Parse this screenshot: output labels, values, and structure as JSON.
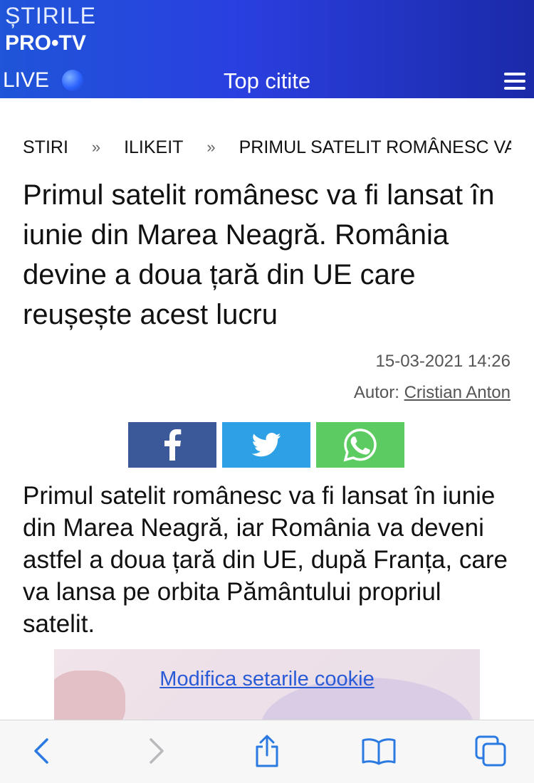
{
  "header": {
    "brand_line1": "ȘTIRILE",
    "brand_line2": "PRO•TV",
    "live_label": "LIVE",
    "top_read_label": "Top citite"
  },
  "breadcrumb": {
    "items": [
      "STIRI",
      "ILIKEIT",
      "PRIMUL SATELIT ROMÂNESC VA FI LANSAT"
    ],
    "separator": "»"
  },
  "article": {
    "title": "Primul satelit românesc va fi lansat în iunie din Marea Neagră. România devine a doua țară din UE care reușește acest lucru",
    "date": "15-03-2021 14:26",
    "author_label": "Autor:",
    "author_name": "Cristian Anton",
    "lead": "Primul satelit românesc va fi lansat în iunie din Marea Neagră, iar România va deveni astfel a doua țară din UE, după Franța, care va lansa pe orbita Pământului propriul satelit."
  },
  "share": {
    "buttons": [
      "facebook-icon",
      "twitter-icon",
      "whatsapp-icon"
    ],
    "colors": {
      "facebook": "#3b5998",
      "twitter": "#2ea1e6",
      "whatsapp": "#5ccc62"
    }
  },
  "cookie": {
    "link_label": "Modifica setarile cookie"
  },
  "toolbar": {
    "icons": [
      "back-icon",
      "forward-icon",
      "share-icon",
      "bookmarks-icon",
      "tabs-icon"
    ]
  },
  "colors": {
    "header_blue": "#2a3fe0",
    "ios_blue": "#2a7ae2"
  }
}
